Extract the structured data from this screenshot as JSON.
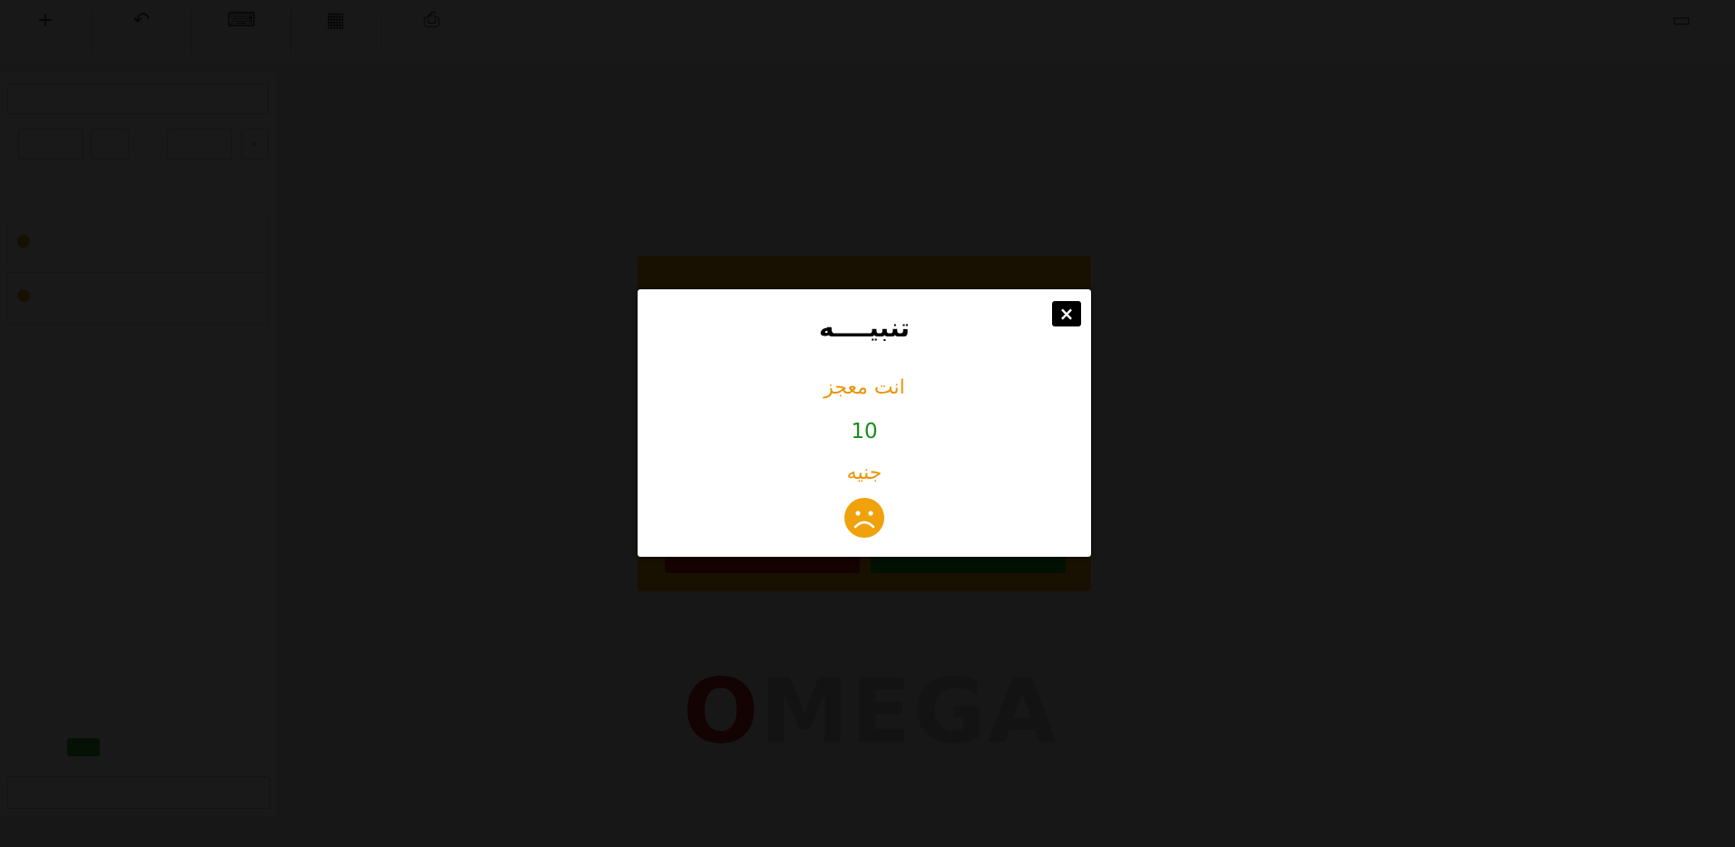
{
  "dialog": {
    "title": "تنبيــــه",
    "message": "انت معجز",
    "amount": "10",
    "currency": "جنيه",
    "close_symbol": "×",
    "status_icon": "sad-face-icon"
  },
  "colors": {
    "accent_orange": "#f4a70a",
    "amount_green": "#1a8a1a",
    "overlay": "rgba(0,0,0,0.9)"
  }
}
